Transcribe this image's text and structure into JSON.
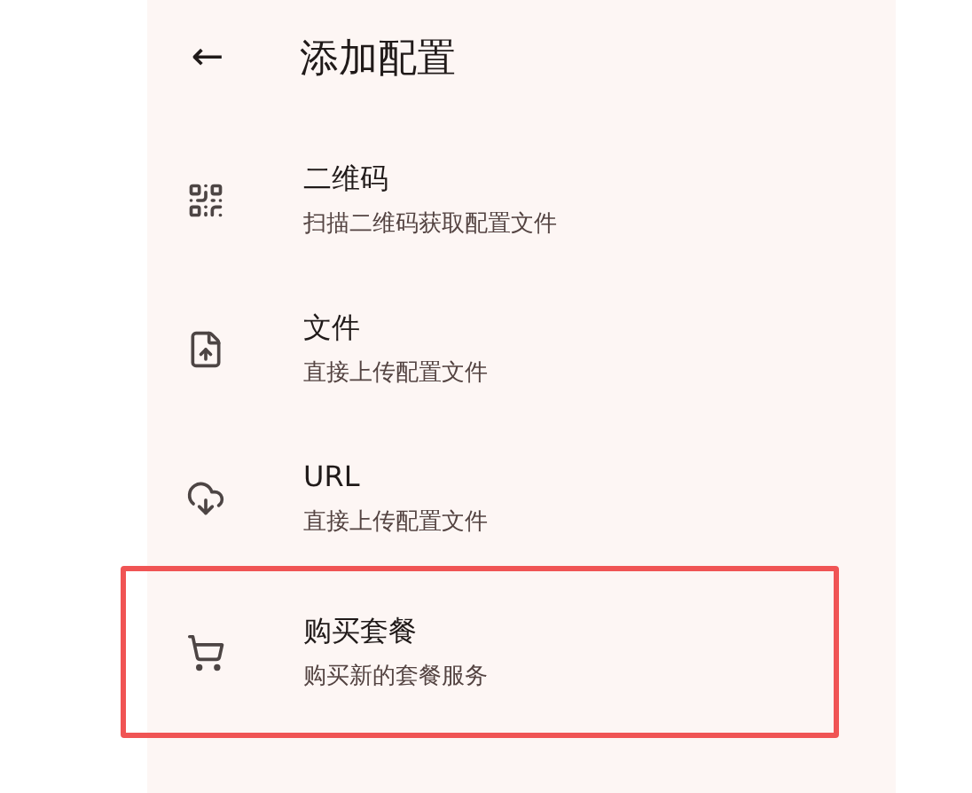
{
  "header": {
    "back": "←",
    "title": "添加配置"
  },
  "items": [
    {
      "kind": "qr",
      "title": "二维码",
      "subtitle": "扫描二维码获取配置文件",
      "highlighted": false
    },
    {
      "kind": "file",
      "title": "文件",
      "subtitle": "直接上传配置文件",
      "highlighted": false
    },
    {
      "kind": "url",
      "title": "URL",
      "subtitle": "直接上传配置文件",
      "highlighted": false
    },
    {
      "kind": "cart",
      "title": "购买套餐",
      "subtitle": "购买新的套餐服务",
      "highlighted": true
    }
  ]
}
